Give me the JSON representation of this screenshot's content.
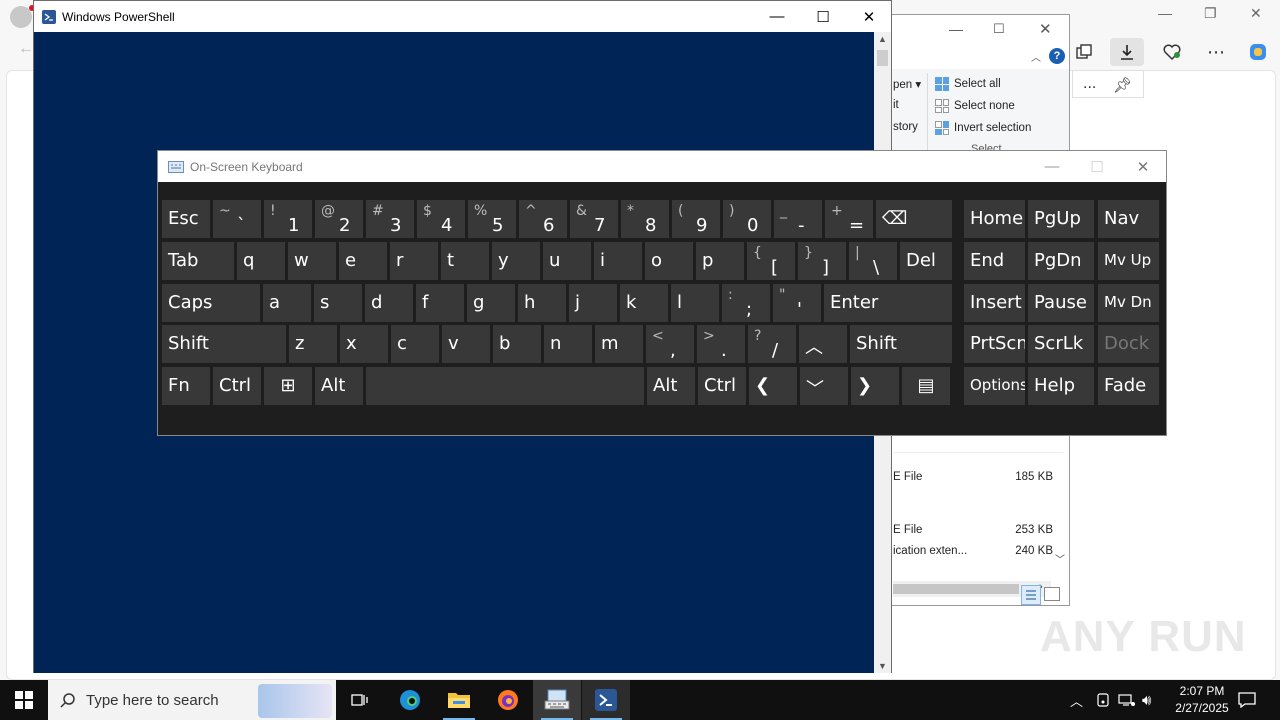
{
  "browser": {
    "page_more_label": "..."
  },
  "explorer": {
    "ribbon_left": [
      "pen ▾",
      "it",
      "story"
    ],
    "select_all": "Select all",
    "select_none": "Select none",
    "invert_selection": "Invert selection",
    "select_group": "Select",
    "files": [
      {
        "type": "E File",
        "size": "185 KB"
      },
      {
        "type": "E File",
        "size": "253 KB"
      },
      {
        "type": "ication exten...",
        "size": "240 KB"
      }
    ]
  },
  "powershell": {
    "title": "Windows PowerShell"
  },
  "osk": {
    "title": "On-Screen Keyboard",
    "rows": [
      [
        {
          "label": "Esc",
          "w": 48
        },
        {
          "top": "~",
          "bot": "`",
          "w": 48
        },
        {
          "top": "!",
          "bot": "1",
          "w": 48
        },
        {
          "top": "@",
          "bot": "2",
          "w": 48
        },
        {
          "top": "#",
          "bot": "3",
          "w": 48
        },
        {
          "top": "$",
          "bot": "4",
          "w": 48
        },
        {
          "top": "%",
          "bot": "5",
          "w": 48
        },
        {
          "top": "^",
          "bot": "6",
          "w": 48
        },
        {
          "top": "&",
          "bot": "7",
          "w": 48
        },
        {
          "top": "*",
          "bot": "8",
          "w": 48
        },
        {
          "top": "(",
          "bot": "9",
          "w": 48
        },
        {
          "top": ")",
          "bot": "0",
          "w": 48
        },
        {
          "top": "_",
          "bot": "-",
          "w": 48
        },
        {
          "top": "+",
          "bot": "=",
          "w": 48
        },
        {
          "label": "⌫",
          "w": 76,
          "icon": "backspace-icon"
        }
      ],
      [
        {
          "label": "Tab",
          "w": 72
        },
        {
          "label": "q",
          "w": 48
        },
        {
          "label": "w",
          "w": 48
        },
        {
          "label": "e",
          "w": 48
        },
        {
          "label": "r",
          "w": 48
        },
        {
          "label": "t",
          "w": 48
        },
        {
          "label": "y",
          "w": 48
        },
        {
          "label": "u",
          "w": 48
        },
        {
          "label": "i",
          "w": 48
        },
        {
          "label": "o",
          "w": 48
        },
        {
          "label": "p",
          "w": 48
        },
        {
          "top": "{",
          "bot": "[",
          "w": 48
        },
        {
          "top": "}",
          "bot": "]",
          "w": 48
        },
        {
          "top": "|",
          "bot": "\\",
          "w": 48
        },
        {
          "label": "Del",
          "w": 52
        }
      ],
      [
        {
          "label": "Caps",
          "w": 98
        },
        {
          "label": "a",
          "w": 48
        },
        {
          "label": "s",
          "w": 48
        },
        {
          "label": "d",
          "w": 48
        },
        {
          "label": "f",
          "w": 48
        },
        {
          "label": "g",
          "w": 48
        },
        {
          "label": "h",
          "w": 48
        },
        {
          "label": "j",
          "w": 48
        },
        {
          "label": "k",
          "w": 48
        },
        {
          "label": "l",
          "w": 48
        },
        {
          "top": ":",
          "bot": ";",
          "w": 48
        },
        {
          "top": "\"",
          "bot": "'",
          "w": 48
        },
        {
          "label": "Enter",
          "w": 128
        }
      ],
      [
        {
          "label": "Shift",
          "w": 124
        },
        {
          "label": "z",
          "w": 48
        },
        {
          "label": "x",
          "w": 48
        },
        {
          "label": "c",
          "w": 48
        },
        {
          "label": "v",
          "w": 48
        },
        {
          "label": "b",
          "w": 48
        },
        {
          "label": "n",
          "w": 48
        },
        {
          "label": "m",
          "w": 48
        },
        {
          "top": "<",
          "bot": ",",
          "w": 48
        },
        {
          "top": ">",
          "bot": ".",
          "w": 48
        },
        {
          "top": "?",
          "bot": "/",
          "w": 48
        },
        {
          "label": "︿",
          "w": 48,
          "icon": "arrow-up-icon"
        },
        {
          "label": "Shift",
          "w": 102
        }
      ],
      [
        {
          "label": "Fn",
          "w": 48
        },
        {
          "label": "Ctrl",
          "w": 48
        },
        {
          "label": "⊞",
          "w": 48,
          "icon": "windows-key-icon",
          "center": true
        },
        {
          "label": "Alt",
          "w": 48
        },
        {
          "label": "",
          "w": 278,
          "name": "space"
        },
        {
          "label": "Alt",
          "w": 48
        },
        {
          "label": "Ctrl",
          "w": 48
        },
        {
          "label": "❮",
          "w": 48,
          "icon": "arrow-left-icon"
        },
        {
          "label": "﹀",
          "w": 48,
          "icon": "arrow-down-icon"
        },
        {
          "label": "❯",
          "w": 48,
          "icon": "arrow-right-icon"
        },
        {
          "label": "▤",
          "w": 48,
          "icon": "menu-key-icon",
          "center": true
        }
      ]
    ],
    "nav_keys": [
      [
        "Home",
        "PgUp",
        "Nav"
      ],
      [
        "End",
        "PgDn",
        "Mv Up"
      ],
      [
        "Insert",
        "Pause",
        "Mv Dn"
      ],
      [
        "PrtScn",
        "ScrLk",
        "Dock"
      ],
      [
        "Options",
        "Help",
        "Fade"
      ]
    ]
  },
  "watermark": "ANY RUN",
  "taskbar": {
    "search_placeholder": "Type here to search",
    "time": "2:07 PM",
    "date": "2/27/2025"
  }
}
